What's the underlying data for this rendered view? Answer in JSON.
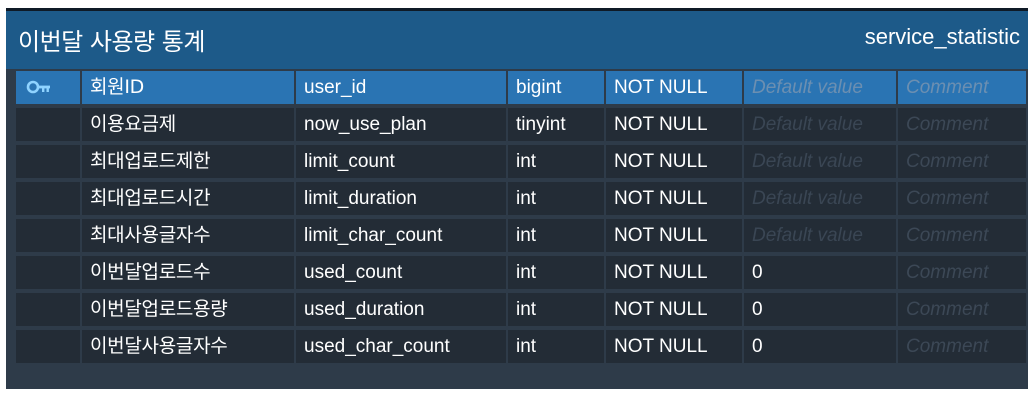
{
  "table": {
    "title": "이번달 사용량 통계",
    "entity_name": "service_statistic",
    "key_icon": "key-icon",
    "placeholders": {
      "default": "Default value",
      "comment": "Comment"
    },
    "columns": [
      {
        "logical": "회원ID",
        "physical": "user_id",
        "type": "bigint",
        "nullability": "NOT NULL",
        "default": "",
        "primary_key": true
      },
      {
        "logical": "이용요금제",
        "physical": "now_use_plan",
        "type": "tinyint",
        "nullability": "NOT NULL",
        "default": ""
      },
      {
        "logical": "최대업로드제한",
        "physical": "limit_count",
        "type": "int",
        "nullability": "NOT NULL",
        "default": ""
      },
      {
        "logical": "최대업로드시간",
        "physical": "limit_duration",
        "type": "int",
        "nullability": "NOT NULL",
        "default": ""
      },
      {
        "logical": "최대사용글자수",
        "physical": "limit_char_count",
        "type": "int",
        "nullability": "NOT NULL",
        "default": ""
      },
      {
        "logical": "이번달업로드수",
        "physical": "used_count",
        "type": "int",
        "nullability": "NOT NULL",
        "default": "0"
      },
      {
        "logical": "이번달업로드용량",
        "physical": "used_duration",
        "type": "int",
        "nullability": "NOT NULL",
        "default": "0"
      },
      {
        "logical": "이번달사용글자수",
        "physical": "used_char_count",
        "type": "int",
        "nullability": "NOT NULL",
        "default": "0"
      }
    ]
  },
  "colors": {
    "header_bg": "#1d5a89",
    "selected_row_bg": "#2a74b3",
    "cell_bg": "#232c36",
    "card_bg": "#2e3b49",
    "key_icon": "#8fd3ff"
  }
}
